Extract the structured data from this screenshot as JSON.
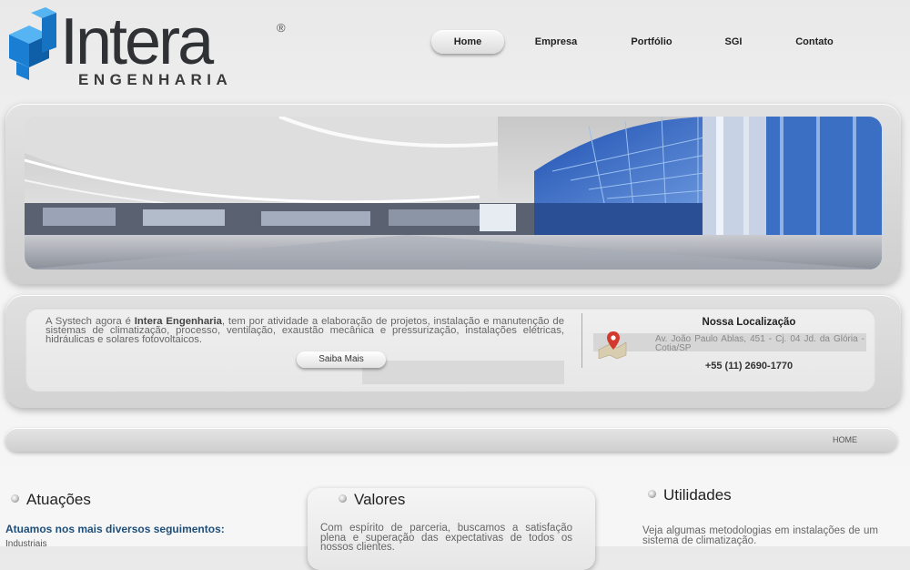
{
  "brand": {
    "name": "Intera",
    "sub": "ENGENHARIA",
    "reg": "®"
  },
  "nav": [
    {
      "label": "Home",
      "active": true
    },
    {
      "label": "Empresa",
      "active": false
    },
    {
      "label": "Portfólio",
      "active": false
    },
    {
      "label": "SGI",
      "active": false
    },
    {
      "label": "Contato",
      "active": false
    }
  ],
  "info": {
    "text_before": "A Systech agora é ",
    "text_bold": "Intera Engenharia",
    "text_after": ", tem por atividade a elaboração de projetos, instalação e manutenção de sistemas de climatização, processo, ventilação, exaustão mecânica e pressurização, instalações elétricas, hidráulicas e solares fotovoltaicos.",
    "button": "Saiba Mais"
  },
  "location": {
    "title": "Nossa Localização",
    "address": "Av. João Paulo Ablas, 451 - Cj. 04 Jd. da Glória - Cotia/SP",
    "phone": "+55 (11) 2690-1770",
    "icon": "map-pin-icon"
  },
  "breadcrumb": "HOME",
  "columns": {
    "atuacoes": {
      "title": "Atuações",
      "subtitle": "Atuamos nos mais diversos seguimentos:",
      "item": "Industriais"
    },
    "valores": {
      "title": "Valores",
      "text": "Com espírito de parceria, buscamos a satisfação plena e superação das expectativas de todos os nossos clientes."
    },
    "utilidades": {
      "title": "Utilidades",
      "text": "Veja algumas metodologias em instalações de um sistema de climatização."
    }
  },
  "colors": {
    "brand_blue": "#1e8fe0",
    "logo_text": "#2f3135",
    "subtitle_blue": "#1e4f7a"
  }
}
